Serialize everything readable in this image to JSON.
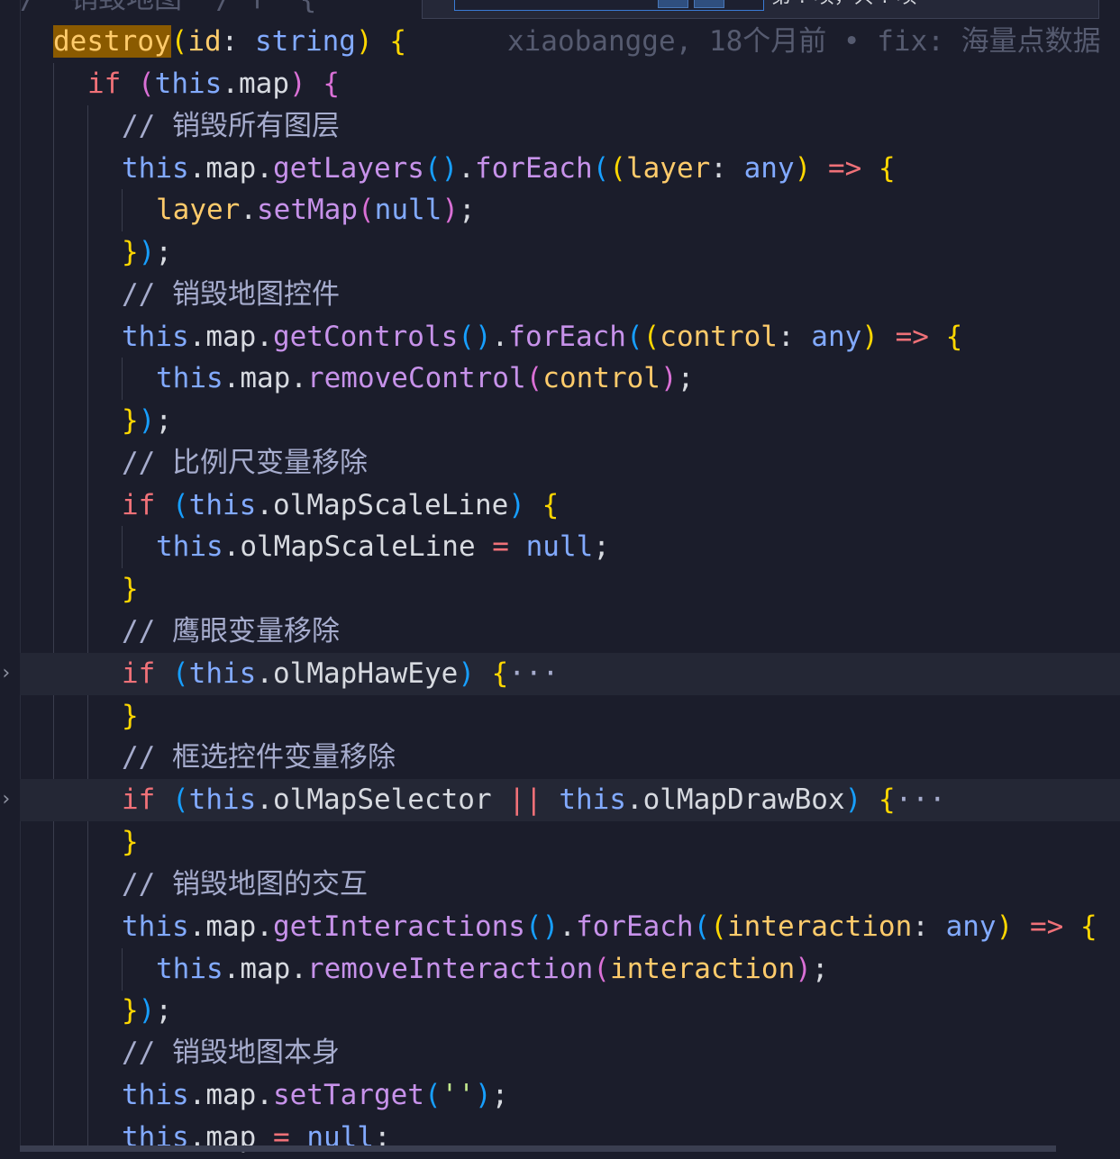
{
  "editor": {
    "top_cut_line": "/  销毁地图  / f  {",
    "blame": "xiaobangge, 18个月前 • fix: 海量点数据",
    "find_widget": {
      "count_label": "第 ? 项，共 ? 项"
    },
    "lines": {
      "l1_fn": "destroy",
      "l1_param": "id",
      "l1_type": "string",
      "l2_cond": "this",
      "l2_prop": "map",
      "c_layers": "// 销毁所有图层",
      "c_controls": "// 销毁地图控件",
      "c_scale": "// 比例尺变量移除",
      "c_eye": "// 鹰眼变量移除",
      "c_select": "// 框选控件变量移除",
      "c_inter": "// 销毁地图的交互",
      "c_self": "// 销毁地图本身",
      "getLayers": "getLayers",
      "forEach": "forEach",
      "layer": "layer",
      "any": "any",
      "setMap": "setMap",
      "null": "null",
      "getControls": "getControls",
      "control": "control",
      "removeControl": "removeControl",
      "olMapScaleLine": "olMapScaleLine",
      "olMapHawEye": "olMapHawEye",
      "olMapSelector": "olMapSelector",
      "olMapDrawBox": "olMapDrawBox",
      "getInteractions": "getInteractions",
      "interaction": "interaction",
      "removeInteraction": "removeInteraction",
      "setTarget": "setTarget",
      "empty_str": "''",
      "ellipsis": "···"
    }
  },
  "colors": {
    "background": "#1b1d2b",
    "keyword": "#f07178",
    "this": "#82aaff",
    "function": "#c792ea",
    "param": "#ffcb6b",
    "comment": "#a6accd",
    "bracket1": "#ffd700",
    "bracket2": "#da70d6",
    "bracket3": "#179fff"
  }
}
